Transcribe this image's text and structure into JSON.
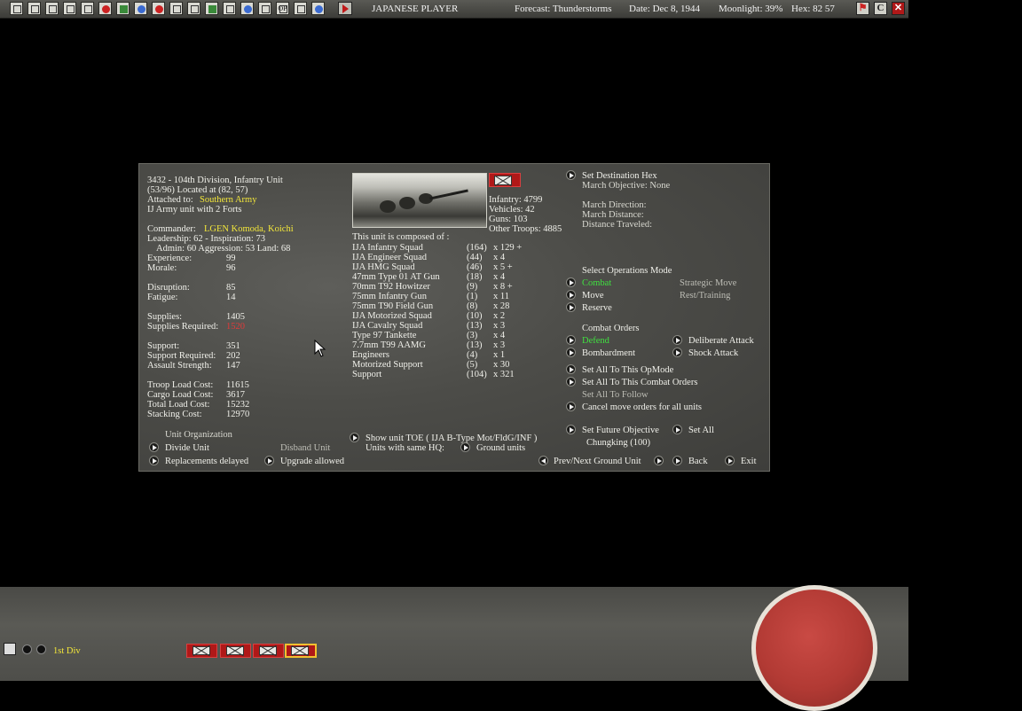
{
  "topbar": {
    "player": "JAPANESE PLAYER",
    "forecast": "Forecast: Thunderstorms",
    "date": "Date: Dec 8, 1944",
    "moonlight": "Moonlight: 39%",
    "hex": "Hex: 82 57",
    "icons": [
      "hq-icon",
      "report-icon",
      "intel-icon",
      "orders-icon",
      "info-icon",
      "sun-flag-icon",
      "air-icon",
      "plane-icon",
      "flag-icon",
      "sea-icon",
      "supply-icon",
      "map-icon",
      "unit-icon",
      "globe-icon",
      "network-icon",
      "op-icon",
      "list-icon",
      "cloud-icon",
      "end-turn-icon"
    ],
    "op_label": "OP",
    "right_btn_c": "C"
  },
  "unit": {
    "title": "3432 - 104th Division, Infantry Unit",
    "location": "(53/96) Located at (82, 57)",
    "attached_label": "Attached to:",
    "attached_value": "Southern Army",
    "forts": "IJ Army unit with 2 Forts",
    "commander_label": "Commander:",
    "commander_value": "LGEN Komoda, Koichi",
    "leadership": "Leadership: 62 - Inspiration: 73",
    "admin": "Admin: 60  Aggression: 53  Land: 68",
    "stats": [
      {
        "label": "Experience:",
        "value": "99"
      },
      {
        "label": "Morale:",
        "value": "96"
      },
      {
        "label": "Disruption:",
        "value": "85"
      },
      {
        "label": "Fatigue:",
        "value": "14"
      },
      {
        "label": "Supplies:",
        "value": "1405"
      },
      {
        "label": "Supplies Required:",
        "value": "1520"
      },
      {
        "label": "Support:",
        "value": "351"
      },
      {
        "label": "Support Required:",
        "value": "202"
      },
      {
        "label": "Assault Strength:",
        "value": "147"
      },
      {
        "label": "Troop Load Cost:",
        "value": "11615"
      },
      {
        "label": "Cargo Load Cost:",
        "value": "3617"
      },
      {
        "label": "Total Load Cost:",
        "value": "15232"
      },
      {
        "label": "Stacking Cost:",
        "value": "12970"
      }
    ],
    "unit_org": "Unit Organization",
    "divide": "Divide Unit",
    "disband": "Disband Unit",
    "replacements": "Replacements delayed",
    "upgrade": "Upgrade allowed"
  },
  "composition": {
    "header": "This unit is composed of :",
    "totals": {
      "infantry": "Infantry: 4799",
      "vehicles": "Vehicles: 42",
      "guns": "Guns: 103",
      "other": "Other Troops: 4885"
    },
    "rows": [
      {
        "name": "IJA Infantry Squad",
        "num": "(164)",
        "mult": "x 129 +"
      },
      {
        "name": "IJA Engineer Squad",
        "num": "(44)",
        "mult": "x 4"
      },
      {
        "name": "IJA HMG Squad",
        "num": "(46)",
        "mult": "x 5 +"
      },
      {
        "name": "47mm Type 01 AT Gun",
        "num": "(18)",
        "mult": "x 4"
      },
      {
        "name": "70mm T92 Howitzer",
        "num": "(9)",
        "mult": "x 8 +"
      },
      {
        "name": "75mm Infantry Gun",
        "num": "(1)",
        "mult": "x 11"
      },
      {
        "name": "75mm T90 Field Gun",
        "num": "(8)",
        "mult": "x 28"
      },
      {
        "name": "IJA Motorized Squad",
        "num": "(10)",
        "mult": "x 2"
      },
      {
        "name": "IJA Cavalry Squad",
        "num": "(13)",
        "mult": "x 3"
      },
      {
        "name": "Type 97 Tankette",
        "num": "(3)",
        "mult": "x 4"
      },
      {
        "name": "7.7mm T99 AAMG",
        "num": "(13)",
        "mult": "x 3"
      },
      {
        "name": "Engineers",
        "num": "(4)",
        "mult": "x 1"
      },
      {
        "name": "Motorized Support",
        "num": "(5)",
        "mult": "x 30"
      },
      {
        "name": "Support",
        "num": "(104)",
        "mult": "x 321"
      }
    ],
    "show_toe": "Show unit TOE ( IJA B-Type Mot/FldG/INF )",
    "same_hq": "Units with same HQ:",
    "ground_units": "Ground units"
  },
  "orders": {
    "set_destination": "Set Destination Hex",
    "march_objective": "March Objective: None",
    "march_direction": "March Direction:",
    "march_distance": "March Distance:",
    "distance_traveled": "Distance Traveled:",
    "select_ops": "Select Operations Mode",
    "combat": "Combat",
    "strategic_move": "Strategic Move",
    "move": "Move",
    "rest_training": "Rest/Training",
    "reserve": "Reserve",
    "combat_orders": "Combat Orders",
    "defend": "Defend",
    "deliberate_attack": "Deliberate Attack",
    "bombardment": "Bombardment",
    "shock_attack": "Shock Attack",
    "set_all_opmode": "Set All To This OpMode",
    "set_all_combat": "Set All To This Combat Orders",
    "set_all_follow": "Set All To Follow",
    "cancel_move": "Cancel move orders for all units",
    "set_future": "Set Future Objective",
    "set_all": "Set All",
    "chungking": "Chungking (100)",
    "prev_next": "Prev/Next Ground Unit",
    "back": "Back",
    "exit": "Exit"
  },
  "bottom": {
    "unit_label": "1st Div"
  },
  "colors": {
    "highlight_yellow": "#f2e63a",
    "warning_red": "#e03a3a",
    "active_green": "#40e040",
    "chip_red": "#b01818"
  }
}
